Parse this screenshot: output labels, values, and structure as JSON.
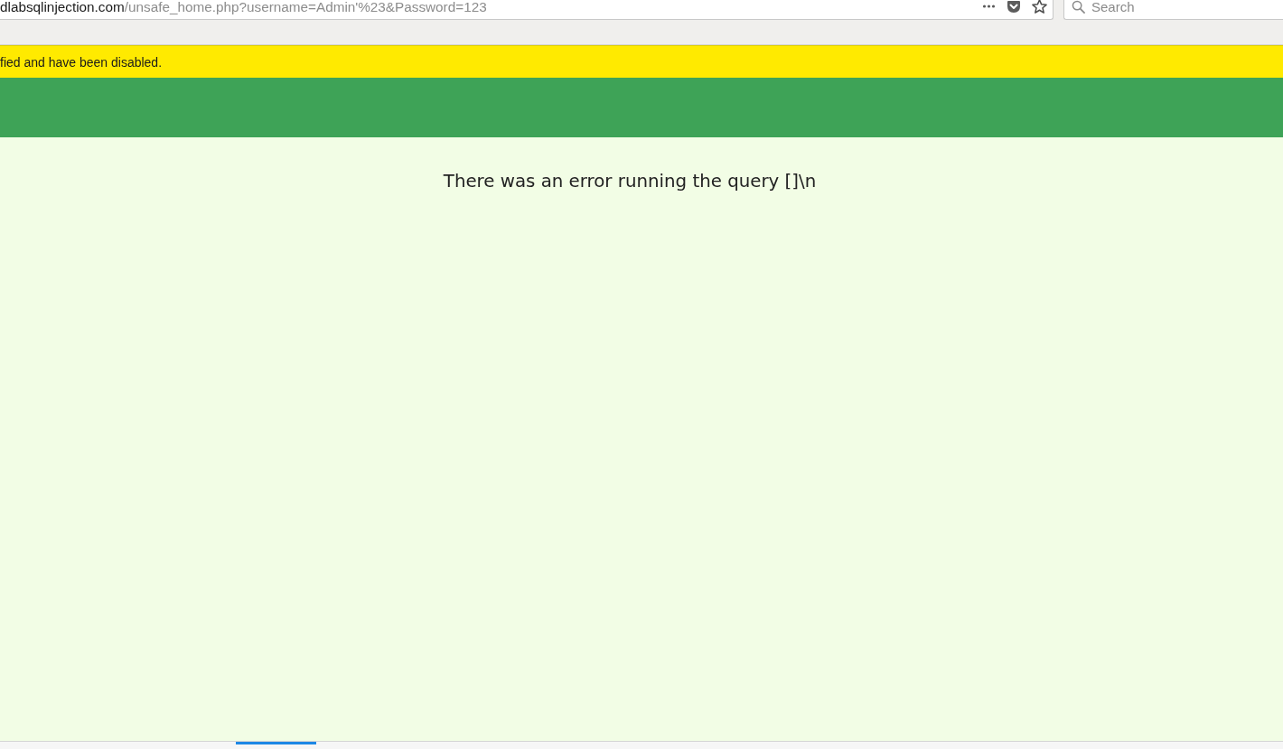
{
  "browser": {
    "url": {
      "host": "dlabsqlinjection.com",
      "path": "/unsafe_home.php?username=Admin'%23&Password=123"
    },
    "search": {
      "placeholder": "Search"
    }
  },
  "notification_bar": {
    "text": "fied and have been disabled."
  },
  "page": {
    "message": "There was an error running the query []\\n"
  }
}
